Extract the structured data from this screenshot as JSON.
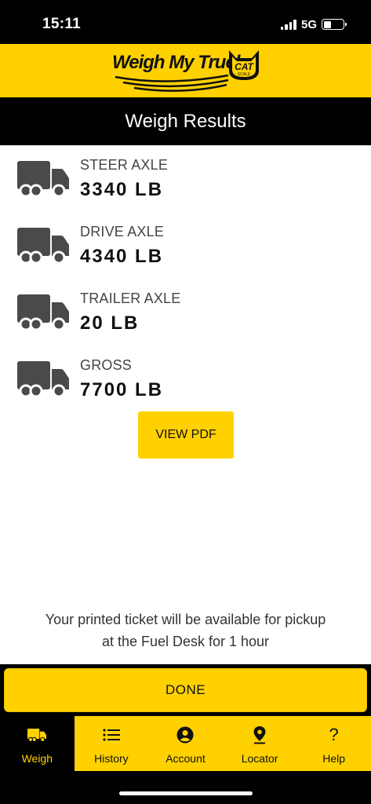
{
  "status_bar": {
    "time": "15:11",
    "network": "5G"
  },
  "brand": {
    "logo_text": "Weigh My Truck",
    "badge_text": "CAT",
    "badge_subtext": "SCALE"
  },
  "header": {
    "title": "Weigh Results"
  },
  "results": [
    {
      "label": "STEER AXLE",
      "value": "3340 LB",
      "icon": "truck-icon"
    },
    {
      "label": "DRIVE AXLE",
      "value": "4340 LB",
      "icon": "truck-icon"
    },
    {
      "label": "TRAILER AXLE",
      "value": "20 LB",
      "icon": "truck-icon"
    },
    {
      "label": "GROSS",
      "value": "7700 LB",
      "icon": "truck-icon"
    }
  ],
  "actions": {
    "view_pdf_label": "VIEW PDF",
    "done_label": "DONE"
  },
  "notice": {
    "line1": "Your printed ticket will be available for pickup",
    "line2": "at the Fuel Desk for 1 hour"
  },
  "tabs": [
    {
      "label": "Weigh",
      "icon": "truck-icon",
      "active": true
    },
    {
      "label": "History",
      "icon": "list-icon",
      "active": false
    },
    {
      "label": "Account",
      "icon": "account-icon",
      "active": false
    },
    {
      "label": "Locator",
      "icon": "location-pin-icon",
      "active": false
    },
    {
      "label": "Help",
      "icon": "question-icon",
      "active": false
    }
  ],
  "colors": {
    "brand_yellow": "#FFD100",
    "black": "#000000",
    "icon_gray": "#4a4a4a"
  }
}
